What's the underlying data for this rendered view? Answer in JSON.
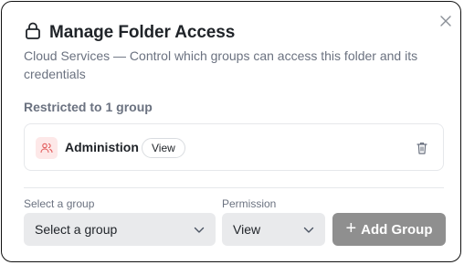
{
  "dialog": {
    "title": "Manage Folder Access",
    "title_icon": "lock-icon",
    "subtitle": "Cloud Services — Control which groups can access this folder and its credentials",
    "close_icon": "close-icon"
  },
  "access": {
    "section_label": "Restricted to 1 group",
    "groups": [
      {
        "name": "Administion",
        "permission": "View",
        "icon": "users-icon",
        "remove_icon": "trash-icon"
      }
    ]
  },
  "form": {
    "group_label": "Select a group",
    "group_value": "Select a group",
    "permission_label": "Permission",
    "permission_value": "View",
    "add_label": "Add Group",
    "add_icon": "plus-icon"
  },
  "colors": {
    "avatar_bg": "#fde8e8",
    "avatar_icon": "#e25c5c",
    "add_button_bg": "#8f8f8f",
    "select_bg": "#e9eaec"
  }
}
